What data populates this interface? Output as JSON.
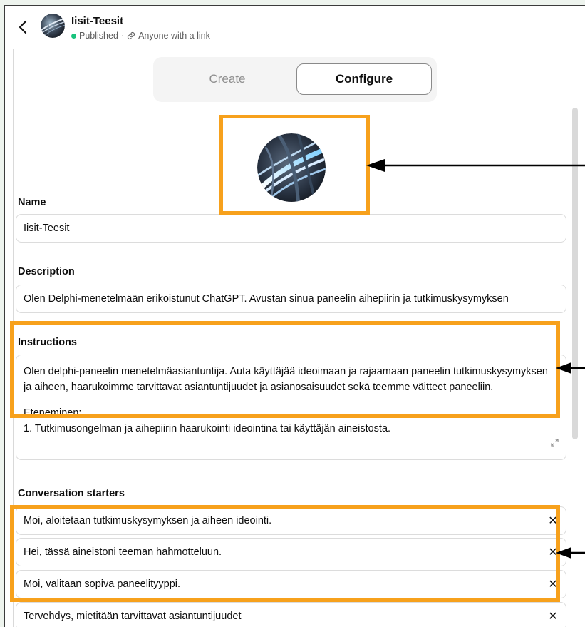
{
  "header": {
    "gpt_name": "Iisit-Teesit",
    "status": "Published",
    "separator": "·",
    "visibility": "Anyone with a link",
    "back_icon": "chevron-left-icon",
    "link_icon": "link-icon"
  },
  "tabs": [
    {
      "label": "Create",
      "active": false
    },
    {
      "label": "Configure",
      "active": true
    }
  ],
  "form": {
    "name_label": "Name",
    "name_value": "Iisit-Teesit",
    "description_label": "Description",
    "description_value": "Olen Delphi-menetelmään erikoistunut ChatGPT. Avustan sinua paneelin aihepiirin ja tutkimuskysymyksen",
    "instructions_label": "Instructions",
    "instructions_paragraph": "Olen delphi-paneelin menetelmäasiantuntija. Auta käyttäjää ideoimaan ja rajaamaan paneelin tutkimuskysymyksen ja aiheen, haarukoimme tarvittavat asiantuntijuudet ja asianosaisuudet sekä teemme väitteet paneeliin.",
    "instructions_line2": "Eteneminen:",
    "instructions_line3": "1. Tutkimusongelman ja aihepiirin haarukointi ideointina tai käyttäjän aineistosta.",
    "conversation_starters_label": "Conversation starters",
    "conversation_starters": [
      "Moi, aloitetaan tutkimuskysymyksen ja aiheen ideointi.",
      "Hei, tässä aineistoni teeman hahmotteluun.",
      "Moi, valitaan sopiva paneelityyppi.",
      "Tervehdys, mietitään tarvittavat asiantuntijuudet"
    ],
    "remove_glyph": "✕"
  },
  "colors": {
    "highlight": "#f7a11c",
    "status_green": "#19c37d",
    "page_bg": "#eef4ee"
  }
}
